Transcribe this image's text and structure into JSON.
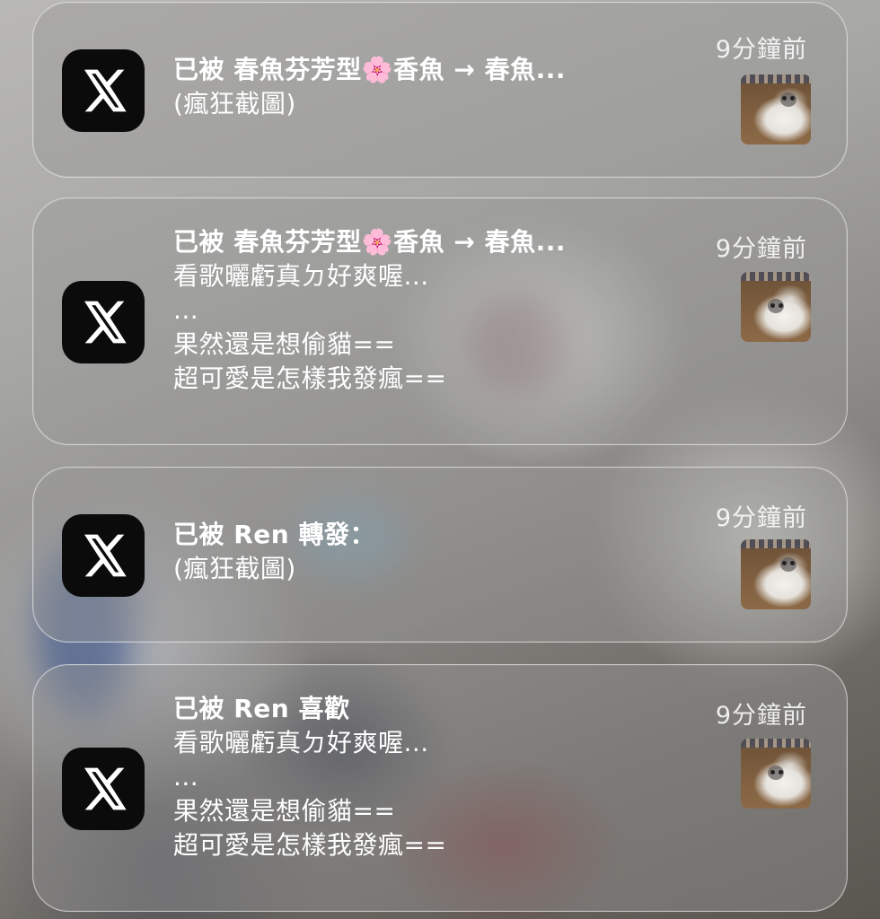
{
  "notifications": [
    {
      "app_icon": "x-logo-icon",
      "title": "已被 春魚芬芳型🌸香魚 → 春魚...",
      "body": [
        "(瘋狂截圖)"
      ],
      "time": "9分鐘前",
      "thumbnail": "cat-photo"
    },
    {
      "app_icon": "x-logo-icon",
      "title": "已被 春魚芬芳型🌸香魚 → 春魚...",
      "body": [
        "看歌曬虧真ㄉ好爽喔...",
        "...",
        "果然還是想偷貓==",
        "超可愛是怎樣我發瘋=="
      ],
      "time": "9分鐘前",
      "thumbnail": "cat-photo"
    },
    {
      "app_icon": "x-logo-icon",
      "title": "已被 Ren 轉發：",
      "body": [
        "(瘋狂截圖)"
      ],
      "time": "9分鐘前",
      "thumbnail": "cat-photo"
    },
    {
      "app_icon": "x-logo-icon",
      "title": "已被 Ren 喜歡",
      "body": [
        "看歌曬虧真ㄉ好爽喔...",
        "...",
        "果然還是想偷貓==",
        "超可愛是怎樣我發瘋=="
      ],
      "time": "9分鐘前",
      "thumbnail": "cat-photo"
    }
  ]
}
